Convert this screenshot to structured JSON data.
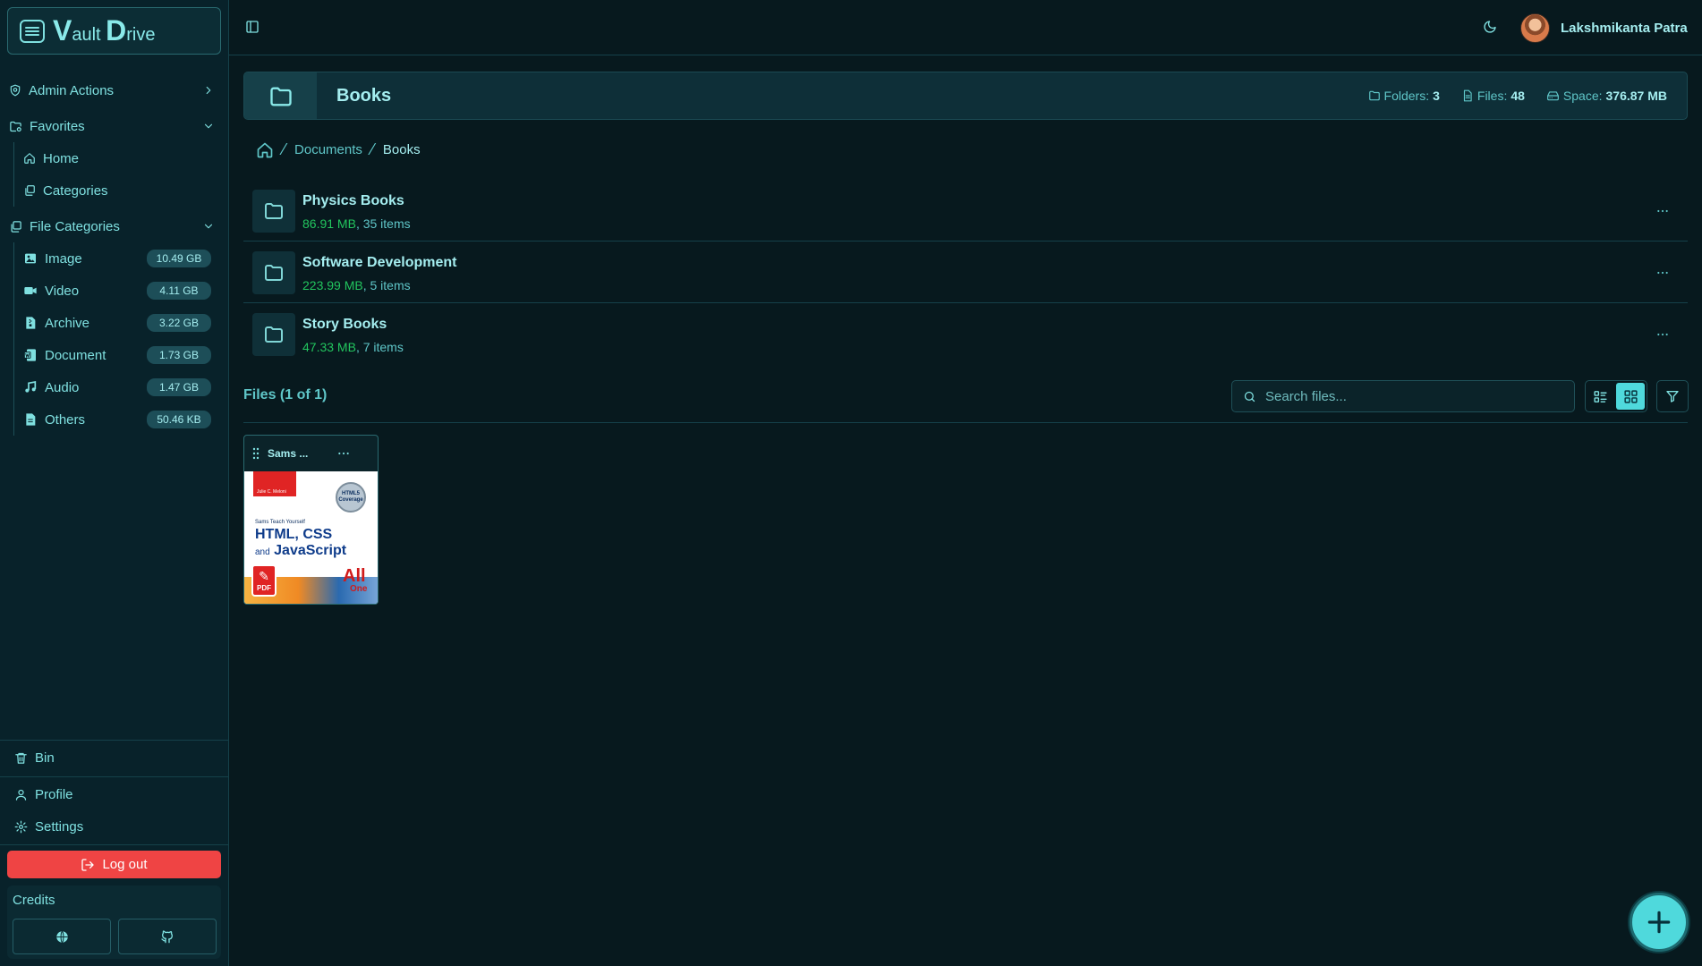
{
  "app": {
    "logo_v": "V",
    "logo_ault": "ault",
    "logo_d": "D",
    "logo_rive": "rive"
  },
  "sidebar": {
    "admin_actions": "Admin Actions",
    "favorites": {
      "label": "Favorites",
      "items": [
        {
          "label": "Home",
          "icon": "home-icon"
        },
        {
          "label": "Categories",
          "icon": "categories-icon"
        }
      ]
    },
    "file_categories": {
      "label": "File Categories",
      "items": [
        {
          "label": "Image",
          "size": "10.49 GB",
          "icon": "image-icon"
        },
        {
          "label": "Video",
          "size": "4.11 GB",
          "icon": "video-icon"
        },
        {
          "label": "Archive",
          "size": "3.22 GB",
          "icon": "archive-icon"
        },
        {
          "label": "Document",
          "size": "1.73 GB",
          "icon": "document-icon"
        },
        {
          "label": "Audio",
          "size": "1.47 GB",
          "icon": "audio-icon"
        },
        {
          "label": "Others",
          "size": "50.46 KB",
          "icon": "file-icon"
        }
      ]
    },
    "bin": "Bin",
    "profile": "Profile",
    "settings": "Settings",
    "logout": "Log out",
    "credits": "Credits"
  },
  "topbar": {
    "user_name": "Lakshmikanta Patra"
  },
  "folder_header": {
    "title": "Books",
    "folders_label": "Folders:",
    "folders_value": "3",
    "files_label": "Files:",
    "files_value": "48",
    "space_label": "Space:",
    "space_value": "376.87 MB"
  },
  "breadcrumb": {
    "items": [
      "Documents",
      "Books"
    ]
  },
  "folders": [
    {
      "name": "Physics Books",
      "size": "86.91 MB",
      "items": ", 35 items"
    },
    {
      "name": "Software Development",
      "size": "223.99 MB",
      "items": ", 5 items"
    },
    {
      "name": "Story Books",
      "size": "47.33 MB",
      "items": ", 7 items"
    }
  ],
  "files": {
    "title": "Files (1 of 1)",
    "search_placeholder": "Search files...",
    "cards": [
      {
        "name": "Sams ...",
        "cover": {
          "author": "Julie C. Meloni",
          "seal_line1": "HTML5",
          "seal_line2": "Coverage",
          "series": "Sams Teach Yourself",
          "title_line1": "HTML, CSS",
          "title_and": "and",
          "title_line2": "JavaScript",
          "all": "All",
          "one": "One",
          "badge": "PDF"
        }
      }
    ]
  },
  "colors": {
    "accent": "#4fd9dc",
    "background": "#07191e",
    "logout": "#ef4444",
    "size_green": "#22c55e"
  }
}
